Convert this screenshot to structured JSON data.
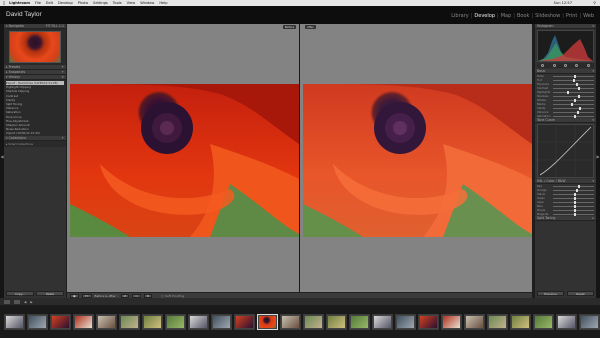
{
  "menubar": {
    "apple": "",
    "items": [
      "Lightroom",
      "File",
      "Edit",
      "Develop",
      "Photo",
      "Settings",
      "Tools",
      "View",
      "Window",
      "Help"
    ],
    "window_title": "",
    "clock": "Sun 12:57",
    "search_icon": "search-icon"
  },
  "identity": {
    "plate": "David Taylor",
    "modules": [
      "Library",
      "Develop",
      "Map",
      "Book",
      "Slideshow",
      "Print",
      "Web"
    ],
    "active_module": "Develop"
  },
  "left_panel": {
    "navigator": "Navigator",
    "presets": "Presets",
    "snapshots": "Snapshots",
    "history": "History",
    "history_items": [
      "Export - Hard Drive (10/30/12 21:28)",
      "Highlight Clipping",
      "Shadow Clipping",
      "Contrast",
      "Clarity",
      "Split Toning",
      "Vibrance",
      "Saturation",
      "Tone Curve",
      "Hue Adjustment",
      "Sharpen Amount",
      "Noise Reduction",
      "Import (10/30/12 21:20)"
    ],
    "collections": "Collections",
    "collection_item": "Smart Collections",
    "copy_btn": "Copy...",
    "paste_btn": "Paste"
  },
  "stage": {
    "before_tag": "Before",
    "after_tag": "After"
  },
  "toolbar": {
    "mode_label": "Before & After :",
    "soft_proof": "Soft Proofing"
  },
  "right_panel": {
    "histogram": "Histogram",
    "basic": "Basic",
    "tone_curve": "Tone Curve",
    "hsl": "HSL / Color / B&W",
    "split_toning": "Split Toning",
    "sliders": [
      "Temp",
      "Tint",
      "Exposure",
      "Contrast",
      "Highlights",
      "Shadows",
      "Whites",
      "Blacks",
      "Clarity",
      "Vibrance",
      "Saturation"
    ],
    "slider_levels": [
      0.5,
      0.48,
      0.55,
      0.62,
      0.35,
      0.6,
      0.52,
      0.45,
      0.64,
      0.58,
      0.5
    ],
    "hsl_sliders": [
      "Red",
      "Orange",
      "Yellow",
      "Green",
      "Aqua",
      "Blue",
      "Purple",
      "Magenta"
    ],
    "hsl_levels": [
      0.6,
      0.55,
      0.5,
      0.5,
      0.5,
      0.5,
      0.5,
      0.5
    ],
    "prev_btn": "Previous",
    "reset_btn": "Reset"
  },
  "filmstrip": {
    "bar_text": "",
    "thumb_count": 30,
    "selected_index": 11
  }
}
